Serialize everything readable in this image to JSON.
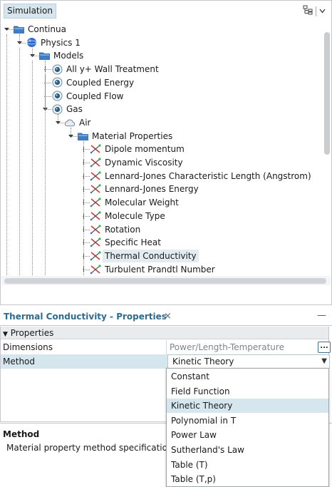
{
  "tree": {
    "tab_label": "Simulation",
    "toolbar_icons": [
      "tree-layout-icon",
      "menu-arrow-icon"
    ],
    "nodes": [
      {
        "label": "Continua",
        "icon": "folder-icon",
        "depth": 0,
        "expanded": true
      },
      {
        "label": "Physics 1",
        "icon": "sphere-icon",
        "depth": 1,
        "expanded": true
      },
      {
        "label": "Models",
        "icon": "folder-icon",
        "depth": 2,
        "expanded": true
      },
      {
        "label": "All y+ Wall Treatment",
        "icon": "model-icon",
        "depth": 3
      },
      {
        "label": "Coupled Energy",
        "icon": "model-icon",
        "depth": 3
      },
      {
        "label": "Coupled Flow",
        "icon": "model-icon",
        "depth": 3
      },
      {
        "label": "Gas",
        "icon": "model-icon",
        "depth": 3,
        "expanded": true
      },
      {
        "label": "Air",
        "icon": "cloud-icon",
        "depth": 4,
        "expanded": true
      },
      {
        "label": "Material Properties",
        "icon": "folder-icon",
        "depth": 5,
        "expanded": true
      },
      {
        "label": "Dipole momentum",
        "icon": "property-icon",
        "depth": 6
      },
      {
        "label": "Dynamic Viscosity",
        "icon": "property-icon",
        "depth": 6
      },
      {
        "label": "Lennard-Jones Characteristic Length (Angstrom)",
        "icon": "property-icon",
        "depth": 6
      },
      {
        "label": "Lennard-Jones Energy",
        "icon": "property-icon",
        "depth": 6
      },
      {
        "label": "Molecular Weight",
        "icon": "property-icon",
        "depth": 6
      },
      {
        "label": "Molecule Type",
        "icon": "property-icon",
        "depth": 6
      },
      {
        "label": "Rotation",
        "icon": "property-icon",
        "depth": 6
      },
      {
        "label": "Specific Heat",
        "icon": "property-icon",
        "depth": 6
      },
      {
        "label": "Thermal Conductivity",
        "icon": "property-icon",
        "depth": 6,
        "selected": true
      },
      {
        "label": "Turbulent Prandtl Number",
        "icon": "property-icon",
        "depth": 6
      }
    ]
  },
  "properties": {
    "title": "Thermal Conductivity - Properties",
    "close_symbol": "×",
    "minimize_symbol": "—",
    "section_label": "Properties",
    "rows": {
      "dimensions": {
        "name": "Dimensions",
        "value": "Power/Length-Temperature",
        "button_label": "..."
      },
      "method": {
        "name": "Method",
        "value": "Kinetic Theory"
      }
    }
  },
  "description": {
    "title": "Method",
    "text": "Material property method specification."
  },
  "method_dropdown": {
    "options": [
      "Constant",
      "Field Function",
      "Kinetic Theory",
      "Polynomial in T",
      "Power Law",
      "Sutherland's Law",
      "Table (T)",
      "Table (T,p)"
    ],
    "selected": "Kinetic Theory"
  },
  "colors": {
    "accent": "#2b6c8f",
    "selection": "#d6e6ee",
    "folder": "#3d7fc4",
    "sphere": "#2f6ad0"
  }
}
